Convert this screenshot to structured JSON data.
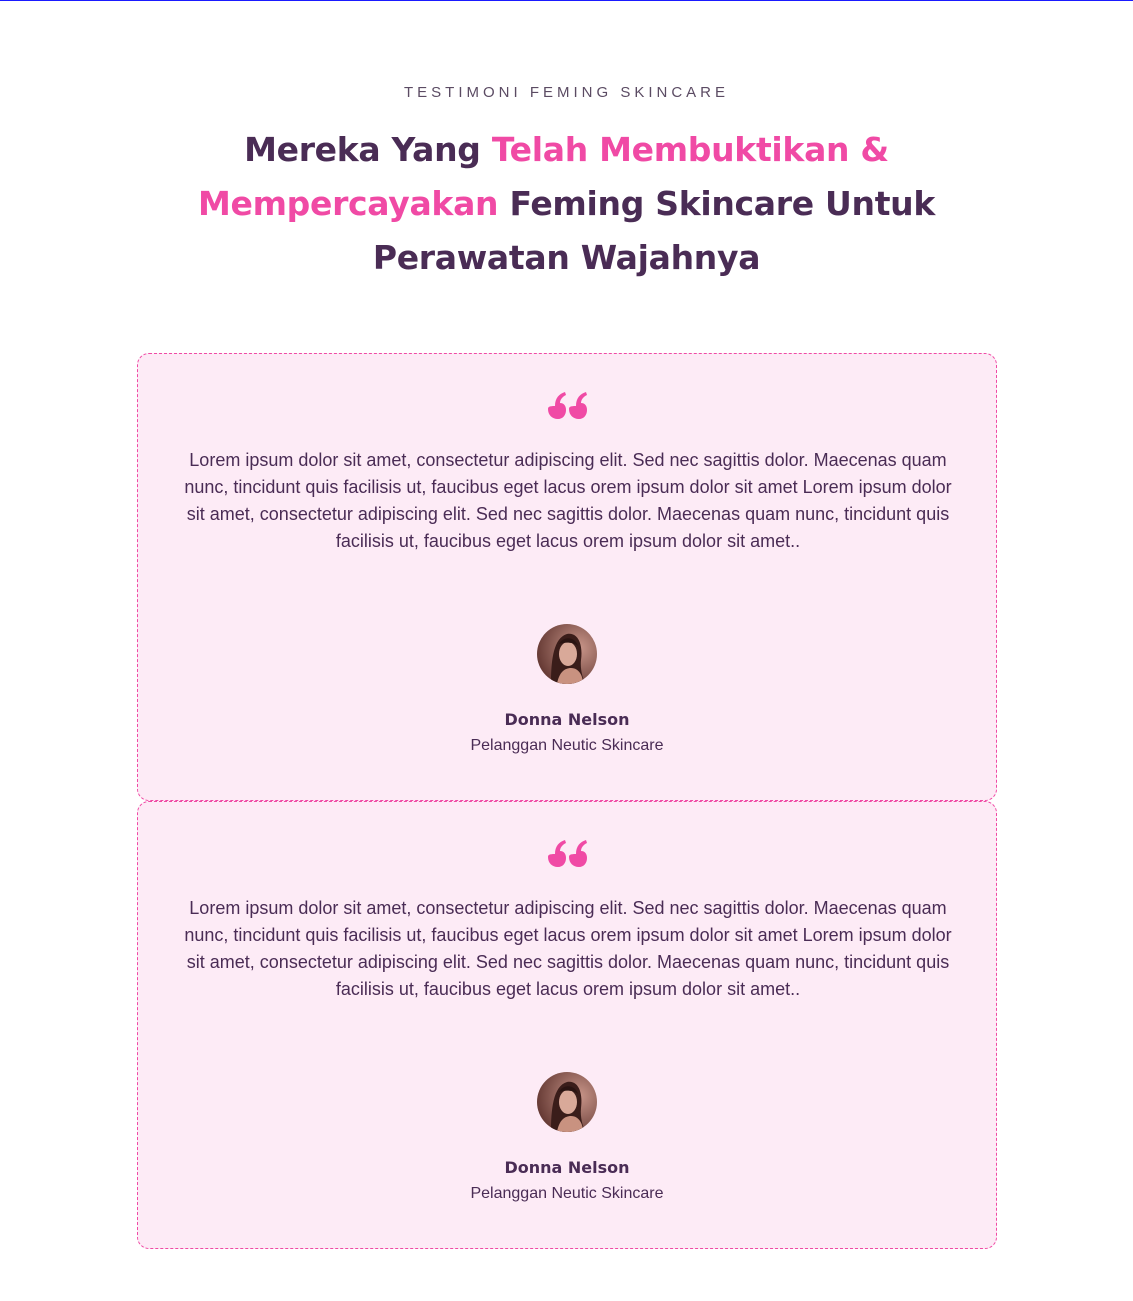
{
  "section": {
    "eyebrow": "TESTIMONI FEMING SKINCARE",
    "headline_parts": [
      {
        "text": "Mereka Yang ",
        "accent": false
      },
      {
        "text": "Telah Membuktikan & Mempercayakan",
        "accent": true
      },
      {
        "text": " Feming Skincare Untuk Perawatan Wajahnya",
        "accent": false
      }
    ]
  },
  "colors": {
    "accent": "#f04aa5",
    "heading": "#4a2c55",
    "card_bg": "#fdebf6"
  },
  "testimonials": [
    {
      "icon": "quote-left-icon",
      "text": "Lorem ipsum dolor sit amet, consectetur adipiscing elit. Sed nec sagittis dolor. Maecenas quam nunc, tincidunt quis facilisis ut, faucibus eget lacus orem ipsum dolor sit amet Lorem ipsum dolor sit amet, consectetur adipiscing elit. Sed nec sagittis dolor. Maecenas quam nunc, tincidunt quis facilisis ut, faucibus eget lacus orem ipsum dolor sit amet..",
      "name": "Donna Nelson",
      "role": "Pelanggan Neutic Skincare"
    },
    {
      "icon": "quote-left-icon",
      "text": "Lorem ipsum dolor sit amet, consectetur adipiscing elit. Sed nec sagittis dolor. Maecenas quam nunc, tincidunt quis facilisis ut, faucibus eget lacus orem ipsum dolor sit amet Lorem ipsum dolor sit amet, consectetur adipiscing elit. Sed nec sagittis dolor. Maecenas quam nunc, tincidunt quis facilisis ut, faucibus eget lacus orem ipsum dolor sit amet..",
      "name": "Donna Nelson",
      "role": "Pelanggan Neutic Skincare"
    }
  ]
}
